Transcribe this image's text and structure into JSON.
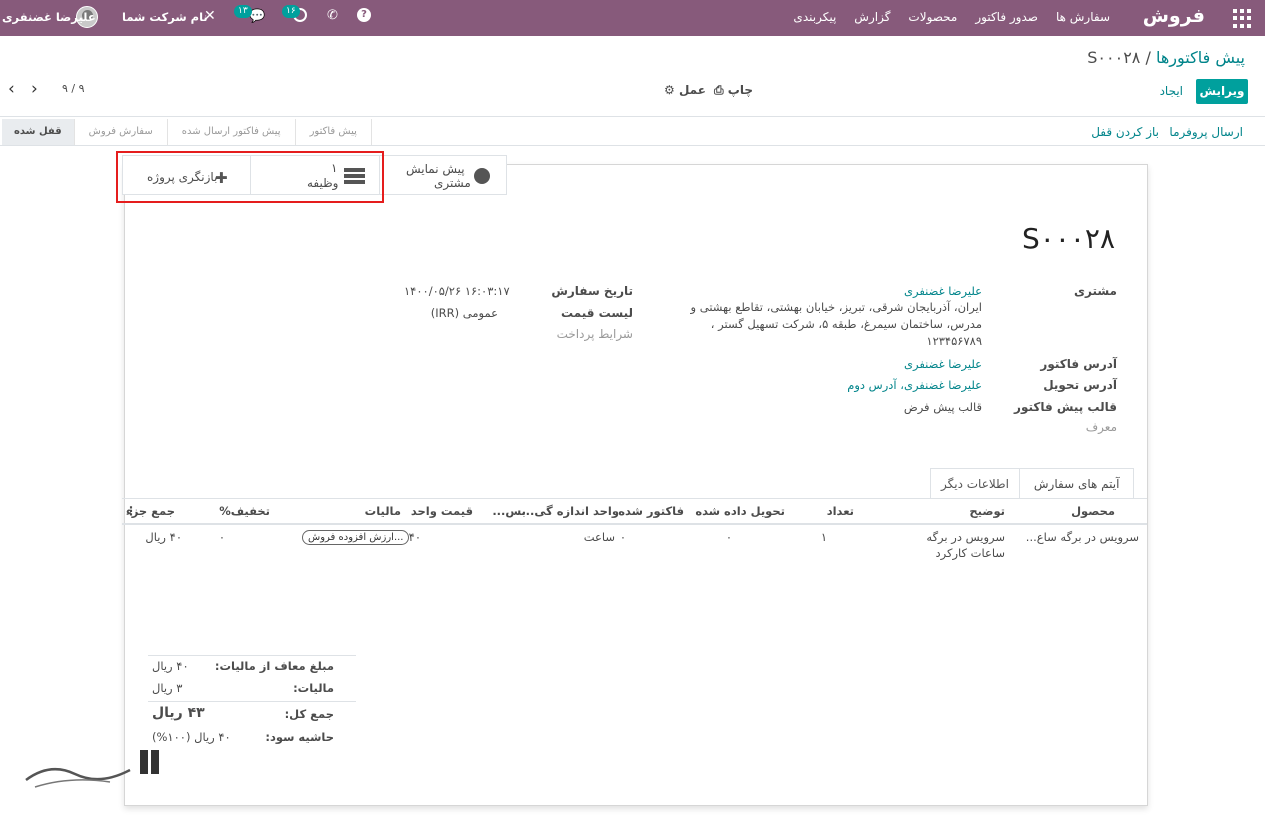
{
  "navbar": {
    "brand": "فروش",
    "menu": [
      "سفارش ها",
      "صدور فاکتور",
      "محصولات",
      "گزارش",
      "پیکربندی"
    ],
    "company": "نام شرکت شما",
    "user": "علیرضا غضنفری",
    "chat_count": "۱۳",
    "activity_count": "۱۶"
  },
  "breadcrumb": {
    "parent": "پیش فاکتورها",
    "separator": "/",
    "current": "S۰۰۰۲۸"
  },
  "buttons": {
    "edit": "ویرایش",
    "create": "ایجاد",
    "print": "چاپ",
    "action": "عمل"
  },
  "pager": {
    "value": "۹ / ۹"
  },
  "statusbar": {
    "send_proforma": "ارسال پروفرما",
    "unlock": "باز کردن قفل",
    "stages": [
      "پیش فاکتور",
      "پیش فاکتور ارسال شده",
      "سفارش فروش",
      "قفل شده"
    ]
  },
  "smart_buttons": {
    "preview_line1": "پیش نمایش",
    "preview_line2": "مشتری",
    "tasks_count": "۱",
    "tasks_label": "وظیفه",
    "project_overview": "بازنگری پروژه"
  },
  "order": {
    "name": "S۰۰۰۲۸",
    "customer_label": "مشتری",
    "customer_name": "علیرضا غضنفری",
    "customer_addr1": "ایران، آذربایجان شرقی، تبریز، خیابان بهشتی، تقاطع بهشتی و",
    "customer_addr2": "مدرس، ساختمان سیمرغ، طبقه ۵، شرکت تسهیل گستر ،",
    "customer_addr3": "۱۲۳۴۵۶۷۸۹",
    "invoice_addr_label": "آدرس فاکتور",
    "invoice_addr": "علیرضا غضنفری",
    "delivery_addr_label": "آدرس تحویل",
    "delivery_addr": "علیرضا غضنفری، آدرس دوم",
    "template_label": "قالب پیش فاکتور",
    "template": "قالب پیش فرض",
    "referrer_label": "معرف",
    "date_label": "تاریخ سفارش",
    "date": "۱۴۰۰/۰۵/۲۶ ۱۶:۰۳:۱۷",
    "pricelist_label": "لیست قیمت",
    "pricelist": "عمومی (IRR)",
    "payment_terms_label": "شرایط پرداخت"
  },
  "tabs": {
    "order_lines": "آیتم های سفارش",
    "other_info": "اطلاعات دیگر"
  },
  "table": {
    "headers": {
      "product": "محصول",
      "description": "توضیح",
      "qty": "تعداد",
      "delivered": "تحویل داده شده",
      "invoiced": "فاکتور شده",
      "uom": "واحد اندازه گی...",
      "pkg": "بس...",
      "price": "قیمت واحد",
      "taxes": "مالیات",
      "discount": "تخفیف%",
      "subtotal": "جمع جزء"
    },
    "row": {
      "product": "سرویس در برگه ساع...",
      "description1": "سرویس در برگه",
      "description2": "ساعات کارکرد",
      "qty": "۱",
      "delivered": "۰",
      "invoiced": "۰",
      "uom": "ساعت",
      "price": "۴۰",
      "tax": "ارزش افزوده فروش...",
      "discount": "۰",
      "subtotal": "۴۰ ریال"
    }
  },
  "totals": {
    "untaxed_label": "مبلغ معاف از مالیات:",
    "untaxed": "۴۰ ریال",
    "tax_label": "مالیات:",
    "tax": "۳ ریال",
    "total_label": "جمع کل:",
    "total": "۴۳ ریال",
    "margin_label": "حاشیه سود:",
    "margin": "۴۰ ریال (۱۰۰%)"
  },
  "colors": {
    "brand": "#875a7b",
    "accent": "#00a09d",
    "link": "#00848a",
    "highlight_box": "#e51d1d"
  }
}
